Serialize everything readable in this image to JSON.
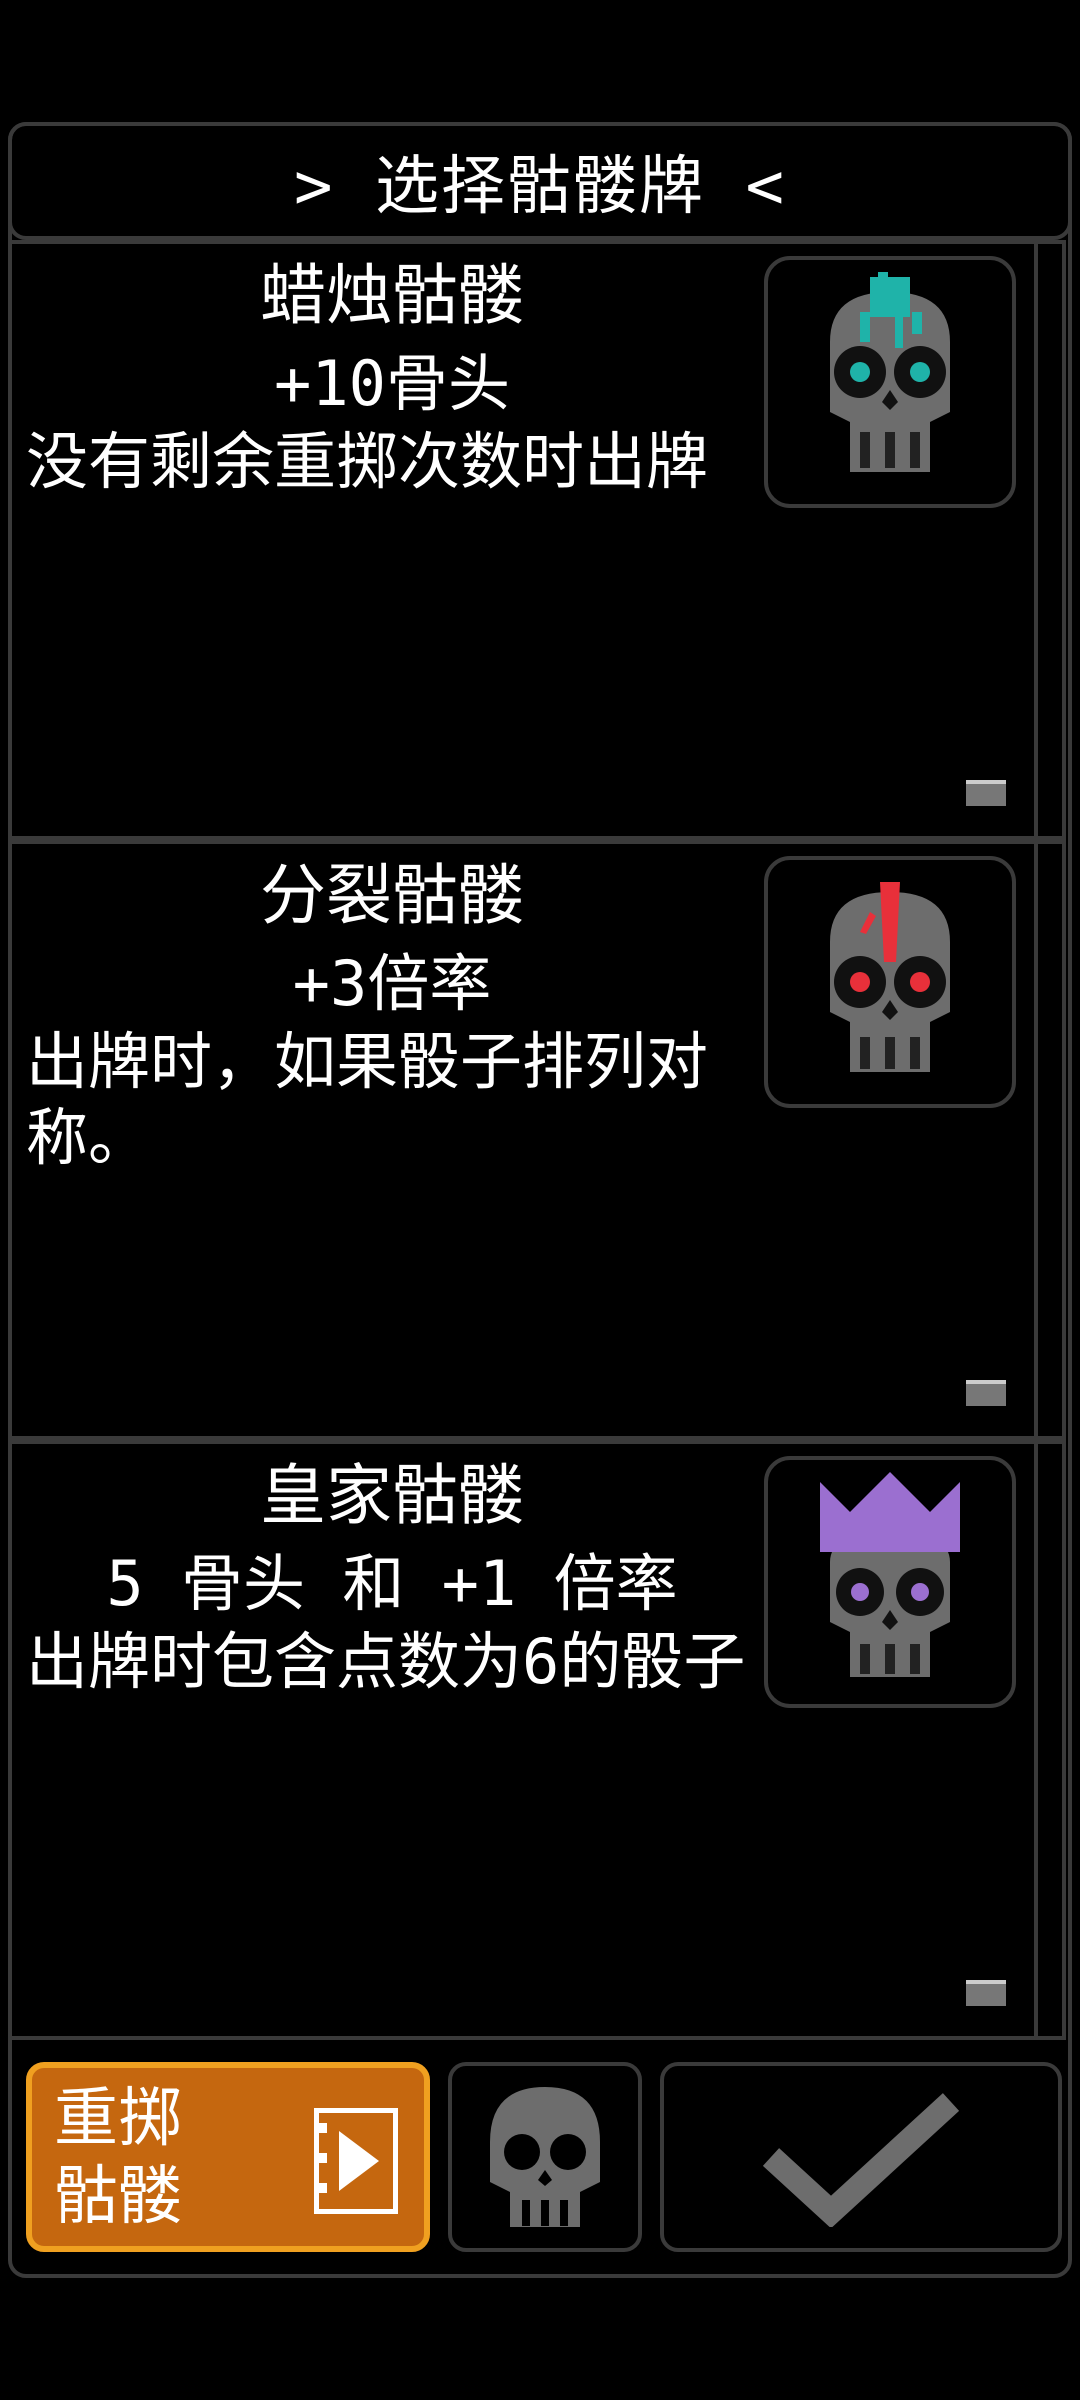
{
  "header": {
    "title": "> 选择骷髅牌 <"
  },
  "cards": [
    {
      "title": "蜡烛骷髅",
      "effect": "+10骨头",
      "desc": "没有剩余重掷次数时出牌",
      "accent": "#1fb3a9"
    },
    {
      "title": "分裂骷髅",
      "effect": "+3倍率",
      "desc": "出牌时，如果骰子排列对称。",
      "accent": "#e8303a"
    },
    {
      "title": "皇家骷髅",
      "effect": "5 骨头 和 +1 倍率",
      "desc": "出牌时包含点数为6的骰子",
      "accent": "#9b6fd0"
    }
  ],
  "footer": {
    "reroll_label_line1": "重掷",
    "reroll_label_line2": "骷髅"
  },
  "colors": {
    "reroll_bg": "#c5670f",
    "reroll_border": "#f0a020",
    "frame": "#3a3a3a"
  }
}
